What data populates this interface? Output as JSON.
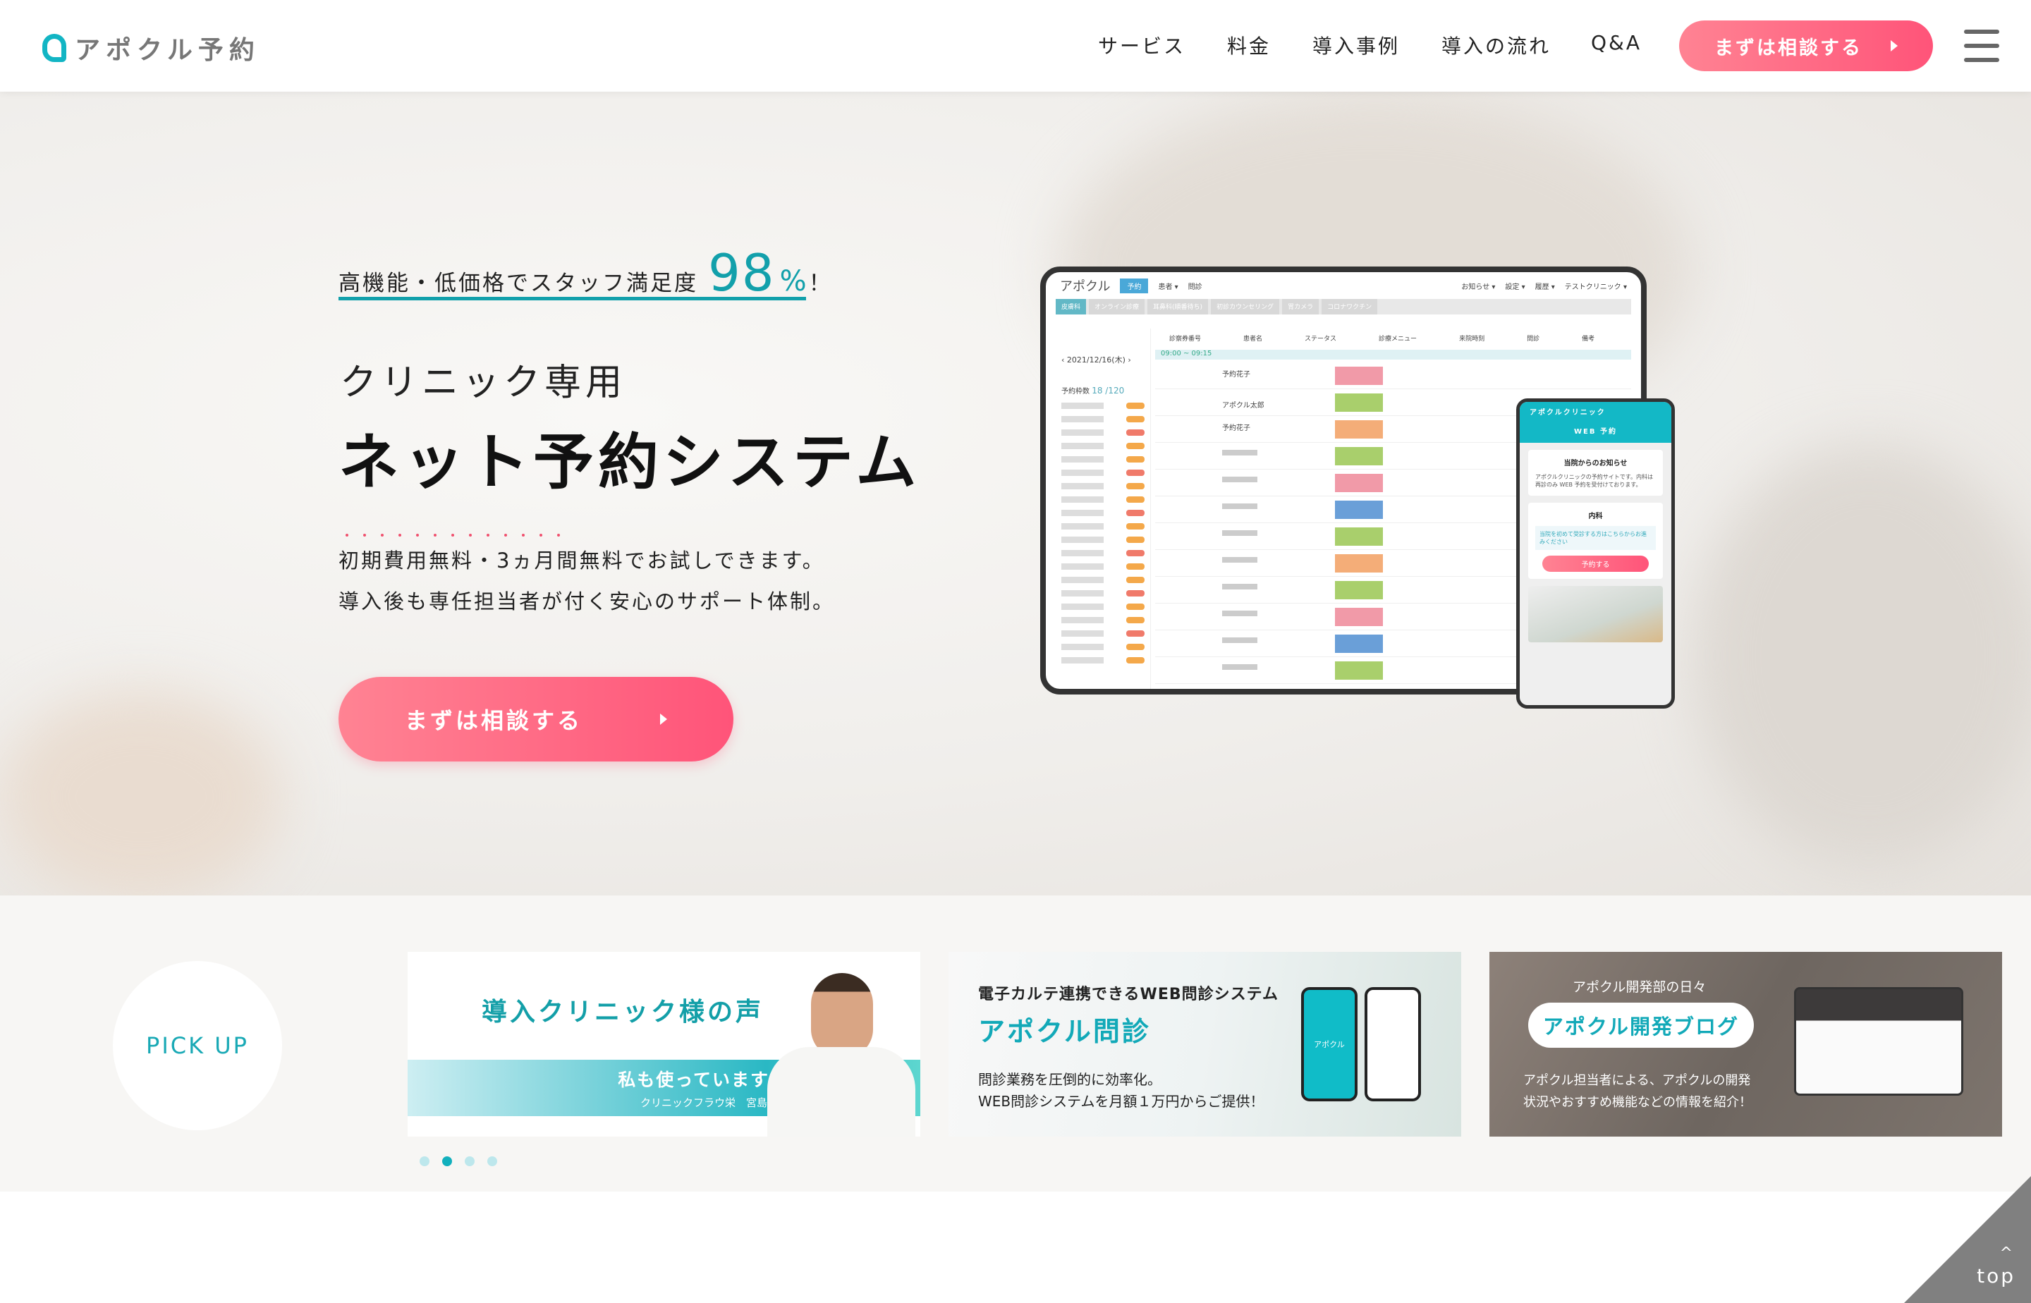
{
  "header": {
    "logo": "アポクル予約",
    "nav": [
      "サービス",
      "料金",
      "導入事例",
      "導入の流れ",
      "Q&A"
    ],
    "cta": "まずは相談する"
  },
  "hero": {
    "tagline": "高機能・低価格でスタッフ満足度",
    "rate": "98",
    "pct": "%",
    "excl": "！",
    "subtitle": "クリニック専用",
    "title": "ネット予約システム",
    "line1": "初期費用無料・3ヵ月間無料でお試しできます。",
    "line2": "導入後も専任担当者が付く安心のサポート体制。",
    "cta": "まずは相談する"
  },
  "tablet": {
    "logo": "アポクル",
    "menu": [
      "予約",
      "患者 ▾",
      "問診"
    ],
    "right": [
      "お知らせ ▾",
      "設定 ▾",
      "履歴 ▾",
      "テストクリニック ▾"
    ],
    "tabs": [
      "皮膚科",
      "オンライン診療",
      "耳鼻科(順番待ち)",
      "初診カウンセリング",
      "胃カメラ",
      "コロナワクチン"
    ],
    "date": "‹ 2021/12/16(木) ›",
    "count_label": "予約枠数",
    "count": "18 /120",
    "cols": [
      "診察券番号",
      "患者名",
      "ステータス",
      "診療メニュー",
      "来院時刻",
      "問診",
      "備考"
    ],
    "slot": "09:00 ~ 09:15",
    "patients": [
      "予約花子",
      "アポクル太郎",
      "予約花子"
    ]
  },
  "phone": {
    "clinic": "アポクルクリニック",
    "web": "WEB 予約",
    "notice_title": "当院からのお知らせ",
    "notice": "アポクルクリニックの予約サイトです。内科は再診のみ WEB 予約を受付けております。",
    "dept": "内科",
    "first": "当院を初めて受診する方はこちらからお進みください",
    "reserve": "予約する"
  },
  "pickup": {
    "label": "PICK UP",
    "card1": {
      "title": "導入クリニック様の声",
      "quote": "私も使っています！",
      "name": "クリニックフラウ栄　宮島院長"
    },
    "card2": {
      "kicker": "電子カルテ連携できるWEB問診システム",
      "title": "アポクル問診",
      "l1": "問診業務を圧倒的に効率化。",
      "l2": "WEB問診システムを月額１万円からご提供！",
      "app": "アポクル"
    },
    "card3": {
      "kicker": "アポクル開発部の日々",
      "title": "アポクル開発ブログ",
      "l1": "アポクル担当者による、アポクルの開発",
      "l2": "状況やおすすめ機能などの情報を紹介！"
    },
    "slides": 4,
    "active_slide": 2
  },
  "totop": "top",
  "colors": {
    "teal": "#12a0ab",
    "pink": "#ff5479"
  }
}
